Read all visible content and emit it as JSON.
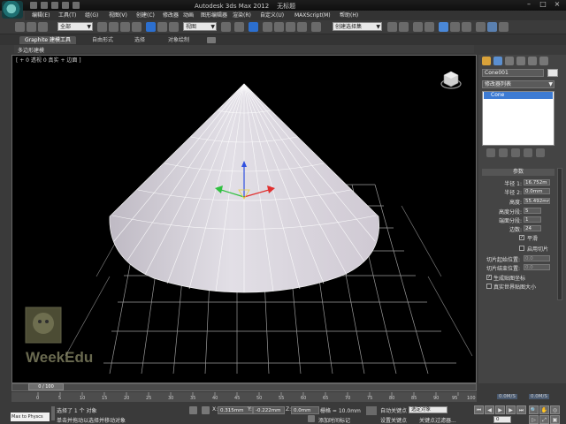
{
  "app": {
    "title": "Autodesk 3ds Max  2012",
    "doc_title": "无标题"
  },
  "menu": [
    "编辑(E)",
    "工具(T)",
    "组(G)",
    "视图(V)",
    "创建(C)",
    "修改器",
    "动画",
    "图形编辑器",
    "渲染(R)",
    "自定义(U)",
    "MAXScript(M)",
    "帮助(H)"
  ],
  "toolbar": {
    "selection_filter": "全部",
    "ref_coord": "视图",
    "named_selection": "创建选择集"
  },
  "ribbon": {
    "tabs": [
      "Graphite 建模工具",
      "自由形式",
      "选择",
      "对象绘制"
    ],
    "sub_label": "多边形建模"
  },
  "viewport": {
    "label": "[ + 0 透视 0 真实 + 边面 ]"
  },
  "panel": {
    "object_name": "Cone001",
    "modifier_list": "修改器列表",
    "stack_item": "Cone",
    "rollout_title": "参数",
    "params": [
      {
        "label": "半径 1:",
        "value": "16.752m"
      },
      {
        "label": "半径 2:",
        "value": "0.0mm"
      },
      {
        "label": "高度:",
        "value": "55.492mm"
      },
      {
        "label": "高度分段:",
        "value": "5"
      },
      {
        "label": "端面分段:",
        "value": "1"
      },
      {
        "label": "边数:",
        "value": "24"
      }
    ],
    "smooth_label": "平滑",
    "slice_on_label": "启用切片",
    "slice_from_label": "切片起始位置:",
    "slice_from_value": "0.0",
    "slice_to_label": "切片结束位置:",
    "slice_to_value": "0.0",
    "gen_map_label": "生成贴图坐标",
    "real_world_label": "真实世界贴图大小"
  },
  "timeline": {
    "frame_label": "0 / 100",
    "ticks": [
      "0",
      "5",
      "10",
      "15",
      "20",
      "25",
      "30",
      "35",
      "40",
      "45",
      "50",
      "55",
      "60",
      "65",
      "70",
      "75",
      "80",
      "85",
      "90",
      "95",
      "100"
    ]
  },
  "status": {
    "listener": "Max to Physcs",
    "selected": "选择了 1 个 对象",
    "prompt": "单击并拖动以选择并移动对象",
    "x_label": "X:",
    "x_value": "0.315mm",
    "y_label": "Y:",
    "y_value": "-0.222mm",
    "z_label": "Z:",
    "z_value": "0.0mm",
    "grid": "栅格 = 10.0mm",
    "add_time_tag": "添加时间标记",
    "auto_key": "自动关键点",
    "set_key": "设置关键点",
    "key_target": "选定对象",
    "key_filters": "关键点过滤器...",
    "frame": "0",
    "speed_a": "0.0M/S",
    "speed_b": "0.0M/S"
  },
  "watermark": {
    "text": "WeekEdu"
  },
  "colors": {
    "viewport_bg": "#000000",
    "stack_highlight": "#3d7bd3",
    "gizmo_x": "#e03030",
    "gizmo_y": "#30c040",
    "gizmo_z": "#3050e0"
  }
}
